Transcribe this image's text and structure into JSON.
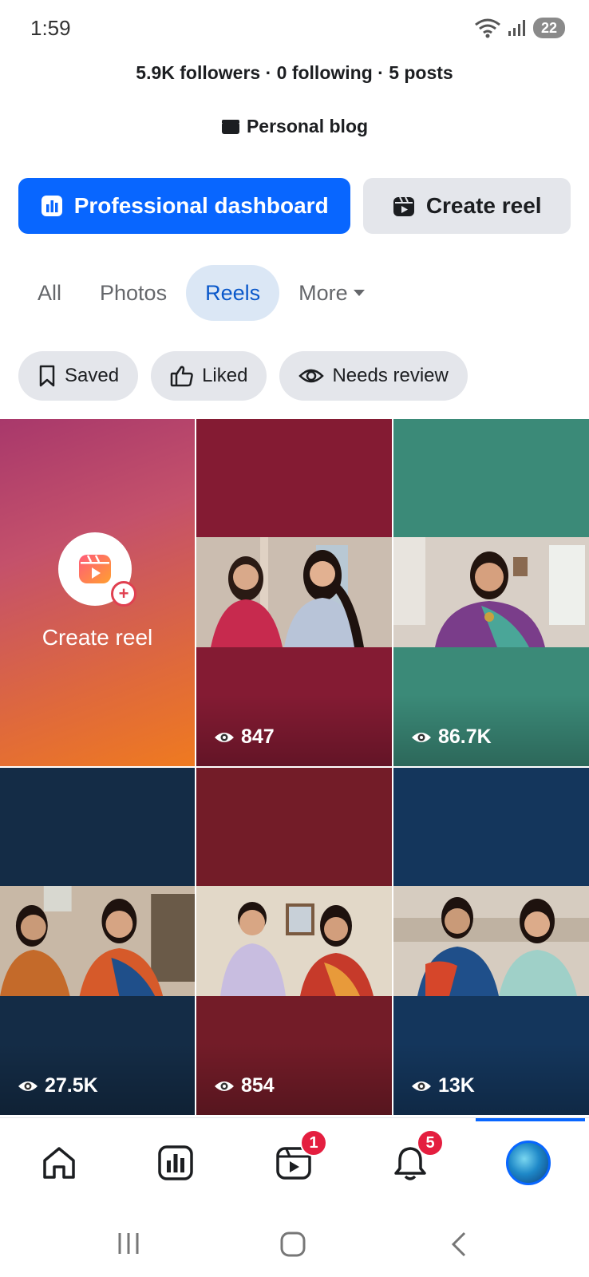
{
  "status_bar": {
    "time": "1:59",
    "battery": "22"
  },
  "profile": {
    "stats": "5.9K followers · 0 following · 5 posts",
    "category": "Personal blog"
  },
  "actions": {
    "dashboard_label": "Professional dashboard",
    "create_reel_label": "Create reel"
  },
  "tabs": [
    {
      "label": "All",
      "active": false
    },
    {
      "label": "Photos",
      "active": false
    },
    {
      "label": "Reels",
      "active": true
    },
    {
      "label": "More",
      "active": false
    }
  ],
  "filters": [
    {
      "label": "Saved",
      "icon": "bookmark-icon"
    },
    {
      "label": "Liked",
      "icon": "thumbs-up-icon"
    },
    {
      "label": "Needs review",
      "icon": "eye-icon"
    }
  ],
  "grid": {
    "create_label": "Create reel",
    "reels": [
      {
        "views": "847",
        "bg": "#841b33"
      },
      {
        "views": "86.7K",
        "bg": "#3b8a78"
      },
      {
        "views": "27.5K",
        "bg": "#142c46"
      },
      {
        "views": "854",
        "bg": "#731c28"
      },
      {
        "views": "13K",
        "bg": "#14365c"
      }
    ]
  },
  "bottom_nav": {
    "items": [
      {
        "icon": "home-icon"
      },
      {
        "icon": "dashboard-icon"
      },
      {
        "icon": "reels-icon",
        "badge": "1"
      },
      {
        "icon": "bell-icon",
        "badge": "5"
      },
      {
        "icon": "profile-avatar",
        "active": true
      }
    ]
  },
  "colors": {
    "accent": "#0866ff",
    "badge": "#e41e3f",
    "chip_bg": "#e4e6eb",
    "active_tab_bg": "#dbe7f5"
  }
}
